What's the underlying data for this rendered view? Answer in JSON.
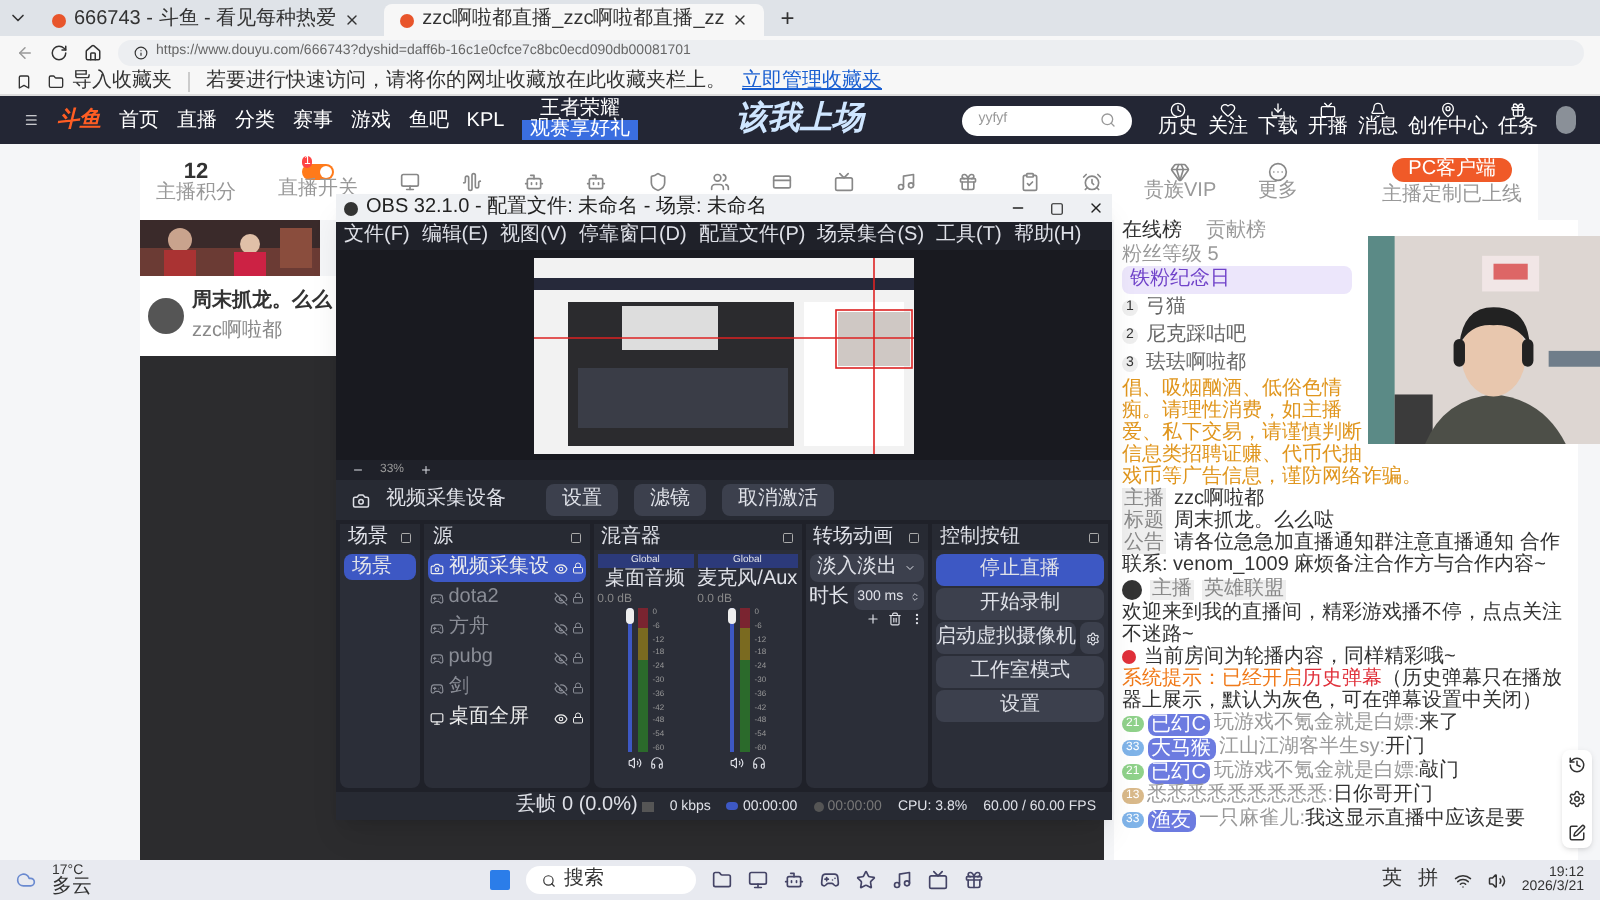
{
  "browser": {
    "tabs": [
      {
        "title": "666743 - 斗鱼 - 看见每种热爱",
        "selected": false
      },
      {
        "title": "zzc啊啦都直播_zzc啊啦都直播_zz",
        "selected": true
      }
    ],
    "new_tab": "+",
    "url": "https://www.douyu.com/666743?dyshid=daff6b-16c1e0cfce7c8bc0ecd090db00081701",
    "bookmarks": {
      "import": "导入收藏夹",
      "hint": "若要进行快速访问，请将你的网址收藏放在此收藏夹栏上。",
      "link": "立即管理收藏夹"
    }
  },
  "site": {
    "logo": "斗鱼",
    "nav": [
      {
        "label": "首页"
      },
      {
        "label": "直播"
      },
      {
        "label": "分类"
      },
      {
        "label": "赛事"
      },
      {
        "label": "游戏"
      },
      {
        "label": "鱼吧"
      },
      {
        "label": "KPL"
      }
    ],
    "promo": {
      "title": "王者荣耀",
      "tag": "观赛享好礼"
    },
    "banner": "该我上场",
    "search": {
      "value": "yyfyf"
    },
    "actions": [
      {
        "label": "历史"
      },
      {
        "label": "关注"
      },
      {
        "label": "下载"
      },
      {
        "label": "开播"
      },
      {
        "label": "消息"
      },
      {
        "label": "创作中心"
      },
      {
        "label": "任务"
      }
    ],
    "tools": [
      {
        "kind": "points",
        "value": "12",
        "label": "主播积分"
      },
      {
        "kind": "toggle",
        "label": "直播开关",
        "on": true,
        "badge": "1"
      },
      {
        "kind": "icon"
      },
      {
        "kind": "icon"
      },
      {
        "kind": "icon"
      },
      {
        "kind": "icon"
      },
      {
        "kind": "icon"
      },
      {
        "kind": "icon"
      },
      {
        "kind": "icon"
      },
      {
        "kind": "icon"
      },
      {
        "kind": "icon"
      },
      {
        "kind": "icon"
      },
      {
        "kind": "icon"
      },
      {
        "kind": "icon"
      },
      {
        "kind": "icon",
        "label": "贵族VIP"
      },
      {
        "kind": "icon",
        "label": "更多"
      }
    ],
    "client": {
      "button": "PC客户端",
      "note": "主播定制已上线"
    },
    "room": {
      "title": "周末抓龙。么么",
      "streamer": "zzc啊啦都"
    }
  },
  "obs": {
    "title": "OBS 32.1.0 - 配置文件: 未命名 - 场景: 未命名",
    "menu": [
      "文件(F)",
      "编辑(E)",
      "视图(V)",
      "停靠窗口(D)",
      "配置文件(P)",
      "场景集合(S)",
      "工具(T)",
      "帮助(H)"
    ],
    "zoom": "33%",
    "source_bar": {
      "name": "视频采集设备",
      "buttons": [
        "设置",
        "滤镜",
        "取消激活"
      ]
    },
    "docks": {
      "scenes": "场景",
      "sources": "源",
      "mixer": "混音器",
      "transitions": "转场动画",
      "controls": "控制按钮"
    },
    "scenes": [
      {
        "name": "场景",
        "selected": true
      }
    ],
    "sources": [
      {
        "name": "视频采集设",
        "kind": "camera",
        "visible": true,
        "selected": true
      },
      {
        "name": "dota2",
        "kind": "game",
        "visible": false,
        "selected": false
      },
      {
        "name": "方舟",
        "kind": "game",
        "visible": false,
        "selected": false
      },
      {
        "name": "pubg",
        "kind": "game",
        "visible": false,
        "selected": false
      },
      {
        "name": "剑",
        "kind": "game",
        "visible": false,
        "selected": false
      },
      {
        "name": "桌面全屏",
        "kind": "display",
        "visible": true,
        "selected": false
      }
    ],
    "mixer": [
      {
        "scope": "Global",
        "name": "桌面音频",
        "db": "0.0 dB",
        "level": 1,
        "scale": [
          "0",
          "-6",
          "-12",
          "-18",
          "-24",
          "-30",
          "-36",
          "-42",
          "-48",
          "-54",
          "-60"
        ]
      },
      {
        "scope": "Global",
        "name": "麦克风/Aux",
        "db": "0.0 dB",
        "level": 1,
        "scale": [
          "0",
          "-6",
          "-12",
          "-18",
          "-24",
          "-30",
          "-36",
          "-42",
          "-48",
          "-54",
          "-60"
        ]
      }
    ],
    "transition": {
      "type": "淡入淡出",
      "duration_label": "时长",
      "duration": "300 ms"
    },
    "controls": [
      {
        "label": "停止直播",
        "kind": "plain",
        "selected": true
      },
      {
        "label": "开始录制",
        "kind": "plain",
        "selected": false
      },
      {
        "label": "启动虚拟摄像机",
        "kind": "split",
        "selected": false
      },
      {
        "label": "工作室模式",
        "kind": "plain",
        "selected": false
      },
      {
        "label": "设置",
        "kind": "plain",
        "selected": false
      }
    ],
    "status": [
      {
        "kind": "frames",
        "text": "丢帧 0 (0.0%)"
      },
      {
        "kind": "rate",
        "text": "0 kbps"
      },
      {
        "kind": "live",
        "text": "00:00:00"
      },
      {
        "kind": "rec",
        "text": "00:00:00"
      },
      {
        "kind": "plain",
        "text": "CPU: 3.8%"
      },
      {
        "kind": "plain",
        "text": "60.00 / 60.00 FPS"
      }
    ]
  },
  "chat": {
    "tabs": [
      {
        "label": "在线榜",
        "selected": true
      },
      {
        "label": "贡献榜",
        "selected": false
      }
    ],
    "fans": "粉丝等级 5",
    "anniversary": "铁粉纪念日",
    "ranking": [
      {
        "rank": "1",
        "name": "弓猫"
      },
      {
        "rank": "2",
        "name": "尼克踩咕吧"
      },
      {
        "rank": "3",
        "name": "珐珐啊啦都"
      }
    ],
    "warning": [
      "倡、吸烟酗酒、低俗色情",
      "痴。请理性消费，如主播",
      "爱、私下交易，请谨慎判断",
      "信息类招聘证赚、代币代抽",
      "戏币等广告信息，谨防网络诈骗。"
    ],
    "meta": [
      {
        "tag": "主播",
        "text": "zzc啊啦都"
      },
      {
        "tag": "标题",
        "text": "周末抓龙。么么哒"
      },
      {
        "tag": "公告",
        "text": "请各位急急加直播通知群注意直播通知 合作联系: venom_1009 麻烦备注合作方与合作内容~"
      }
    ],
    "host": {
      "tags": [
        "主播",
        "英雄联盟"
      ],
      "welcome": "欢迎来到我的直播间，精彩游戏播不停，点点关注不迷路~"
    },
    "notice": "当前房间为轮播内容，同样精彩哦~",
    "system": {
      "label": "系统提示：",
      "before": "已经开启",
      "highlight": "历史弹幕",
      "after": "（历史弹幕只在播放器上展示，默认为灰色，可在弹幕设置中关闭）"
    },
    "messages": [
      {
        "rank": "21",
        "color": "#8fd18a",
        "medal": "已幻C",
        "user": "玩游戏不氪金就是白嫖:",
        "text": "来了"
      },
      {
        "rank": "33",
        "color": "#7fb3e8",
        "medal": "大马猴",
        "user": "江山江湖客半生sy:",
        "text": "开门"
      },
      {
        "rank": "21",
        "color": "#8fd18a",
        "medal": "已幻C",
        "user": "玩游戏不氪金就是白嫖:",
        "text": "敲门"
      },
      {
        "rank": "13",
        "color": "#d9b98a",
        "user": "悉悉悉悉悉悉悉悉悉:",
        "text": "日你哥开门"
      },
      {
        "rank": "33",
        "color": "#7fb3e8",
        "medal": "渔友",
        "user": "一只麻雀儿:",
        "text": "我这显示直播中应该是要"
      }
    ]
  },
  "taskbar": {
    "temp": "17°C",
    "weather": "多云",
    "search": "搜索",
    "ime": [
      "英",
      "拼"
    ],
    "time": "19:12",
    "date": "2026/3/21"
  }
}
